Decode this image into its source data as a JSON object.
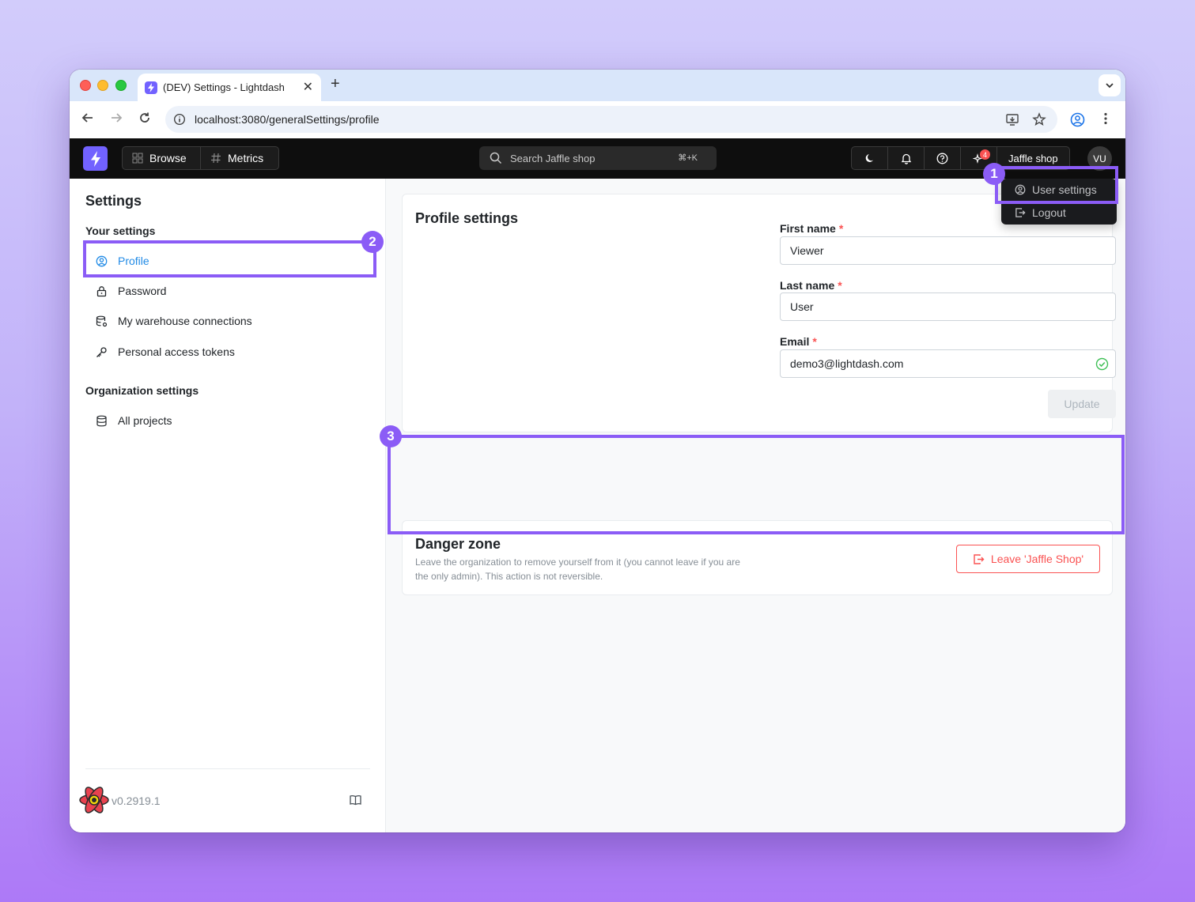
{
  "browser": {
    "tab_title": "(DEV) Settings - Lightdash",
    "new_tab": "+",
    "tab_close": "✕",
    "url": "localhost:3080/generalSettings/profile"
  },
  "header": {
    "nav": [
      {
        "label": "Browse"
      },
      {
        "label": "Metrics"
      }
    ],
    "search_placeholder": "Search Jaffle shop",
    "search_shortcut": "⌘+K",
    "notification_count": "4",
    "project": "Jaffle shop",
    "avatar_initials": "VU"
  },
  "user_menu": {
    "items": [
      {
        "label": "User settings"
      },
      {
        "label": "Logout"
      }
    ]
  },
  "sidebar": {
    "title": "Settings",
    "your_settings_label": "Your settings",
    "your_settings": [
      {
        "label": "Profile"
      },
      {
        "label": "Password"
      },
      {
        "label": "My warehouse connections"
      },
      {
        "label": "Personal access tokens"
      }
    ],
    "org_settings_label": "Organization settings",
    "org_settings": [
      {
        "label": "All projects"
      }
    ],
    "version": "v0.2919.1"
  },
  "profile": {
    "title": "Profile settings",
    "first_name_label": "First name",
    "first_name": "Viewer",
    "last_name_label": "Last name",
    "last_name": "User",
    "email_label": "Email",
    "email": "demo3@lightdash.com",
    "required_mark": "*",
    "update_label": "Update"
  },
  "danger_zone": {
    "title": "Danger zone",
    "description": "Leave the organization to remove yourself from it (you cannot leave if you are the only admin). This action is not reversible.",
    "leave_label": "Leave 'Jaffle Shop'"
  },
  "annotations": [
    "1",
    "2",
    "3"
  ],
  "colors": {
    "accent": "#7262ff",
    "annotation": "#8b5cf6",
    "danger": "#fa5252",
    "active_link": "#228be6"
  }
}
